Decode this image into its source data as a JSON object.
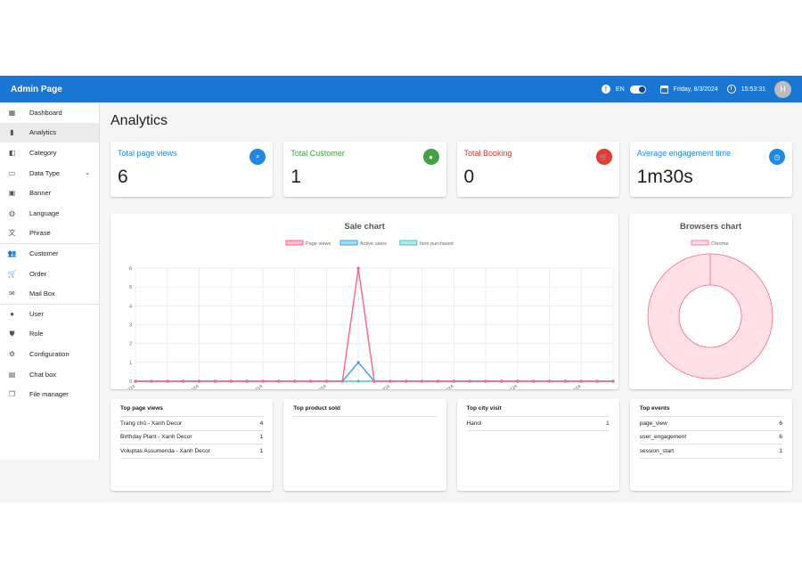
{
  "app": {
    "title": "Admin Page",
    "language": "EN",
    "date": "Friday, 8/3/2024",
    "time": "15:53:31",
    "avatar_initial": "H",
    "accent": "#1976d2"
  },
  "sidebar": {
    "items": [
      {
        "label": "Dashboard",
        "icon": "dashboard-icon"
      },
      {
        "label": "Analytics",
        "icon": "bar-chart-icon",
        "active": true
      },
      {
        "label": "Category",
        "icon": "category-icon"
      },
      {
        "label": "Data Type",
        "icon": "monitor-icon",
        "has_chevron": true
      },
      {
        "label": "Banner",
        "icon": "image-icon"
      },
      {
        "label": "Language",
        "icon": "globe-icon"
      },
      {
        "label": "Phrase",
        "icon": "translate-icon"
      },
      {
        "label": "Customer",
        "icon": "people-icon"
      },
      {
        "label": "Order",
        "icon": "cart-icon"
      },
      {
        "label": "Mail Box",
        "icon": "mail-icon"
      },
      {
        "label": "User",
        "icon": "person-icon"
      },
      {
        "label": "Role",
        "icon": "shield-icon"
      },
      {
        "label": "Configuration",
        "icon": "gear-icon"
      },
      {
        "label": "Chat box",
        "icon": "chat-icon"
      },
      {
        "label": "File manager",
        "icon": "files-icon"
      }
    ]
  },
  "page": {
    "title": "Analytics"
  },
  "stats": [
    {
      "label": "Total page views",
      "value": "6",
      "color": "#1e88e5",
      "icon": "search-page-icon"
    },
    {
      "label": "Total Customer",
      "value": "1",
      "color": "#43a047",
      "icon": "person-icon"
    },
    {
      "label": "Total Booking",
      "value": "0",
      "color": "#e53935",
      "icon": "cart-icon"
    },
    {
      "label": "Average engagement time",
      "value": "1m30s",
      "color": "#1e88e5",
      "icon": "clock-icon"
    }
  ],
  "chart_data": [
    {
      "type": "line",
      "title": "Sale chart",
      "x": [
        "07/02/2024",
        "08/02/2024",
        "09/02/2024",
        "10/02/2024",
        "11/02/2024",
        "12/02/2024",
        "13/02/2024",
        "14/02/2024",
        "15/02/2024",
        "16/02/2024",
        "17/02/2024",
        "18/02/2024",
        "19/02/2024",
        "20/02/2024",
        "21/02/2024",
        "22/02/2024",
        "23/02/2024",
        "24/02/2024",
        "25/02/2024",
        "26/02/2024",
        "27/02/2024",
        "28/02/2024",
        "29/02/2024",
        "01/03/2024",
        "02/03/2024",
        "03/03/2024",
        "04/03/2024",
        "05/03/2024",
        "06/03/2024",
        "07/03/2024",
        "08/03/2024"
      ],
      "x_tick_labels": [
        "07/02/2024",
        "11/02/2024",
        "15/02/2024",
        "19/02/2024",
        "23/02/2024",
        "27/02/2024",
        "02/03/2024",
        "06/03/2024"
      ],
      "series": [
        {
          "name": "Page views",
          "color": "#ff6384",
          "values": [
            0,
            0,
            0,
            0,
            0,
            0,
            0,
            0,
            0,
            0,
            0,
            0,
            0,
            0,
            6,
            0,
            0,
            0,
            0,
            0,
            0,
            0,
            0,
            0,
            0,
            0,
            0,
            0,
            0,
            0,
            0
          ]
        },
        {
          "name": "Active users",
          "color": "#36a2eb",
          "values": [
            0,
            0,
            0,
            0,
            0,
            0,
            0,
            0,
            0,
            0,
            0,
            0,
            0,
            0,
            1,
            0,
            0,
            0,
            0,
            0,
            0,
            0,
            0,
            0,
            0,
            0,
            0,
            0,
            0,
            0,
            0
          ]
        },
        {
          "name": "Item purchased",
          "color": "#4bc0c0",
          "values": [
            0,
            0,
            0,
            0,
            0,
            0,
            0,
            0,
            0,
            0,
            0,
            0,
            0,
            0,
            0,
            0,
            0,
            0,
            0,
            0,
            0,
            0,
            0,
            0,
            0,
            0,
            0,
            0,
            0,
            0,
            0
          ]
        }
      ],
      "ylim": [
        0,
        6
      ],
      "y_ticks": [
        0,
        1,
        2,
        3,
        4,
        5,
        6
      ],
      "grid": true,
      "legend": "top"
    },
    {
      "type": "pie",
      "title": "Browsers chart",
      "categories": [
        "Chrome"
      ],
      "values": [
        1
      ],
      "colors": [
        "#ffe0e6"
      ],
      "border_color": "#ff6384",
      "legend": "top"
    }
  ],
  "tables": [
    {
      "header": "Top page views",
      "rows": [
        {
          "label": "Trang chủ - Xanh Decor",
          "value": "4"
        },
        {
          "label": "Birthday Plant - Xanh Decor",
          "value": "1"
        },
        {
          "label": "Voluptas Assumenda - Xanh Decor",
          "value": "1"
        }
      ]
    },
    {
      "header": "Top product sold",
      "rows": []
    },
    {
      "header": "Top city visit",
      "rows": [
        {
          "label": "Hanoi",
          "value": "1"
        }
      ]
    },
    {
      "header": "Top events",
      "rows": [
        {
          "label": "page_view",
          "value": "6"
        },
        {
          "label": "user_engagement",
          "value": "6"
        },
        {
          "label": "session_start",
          "value": "1"
        }
      ]
    }
  ]
}
